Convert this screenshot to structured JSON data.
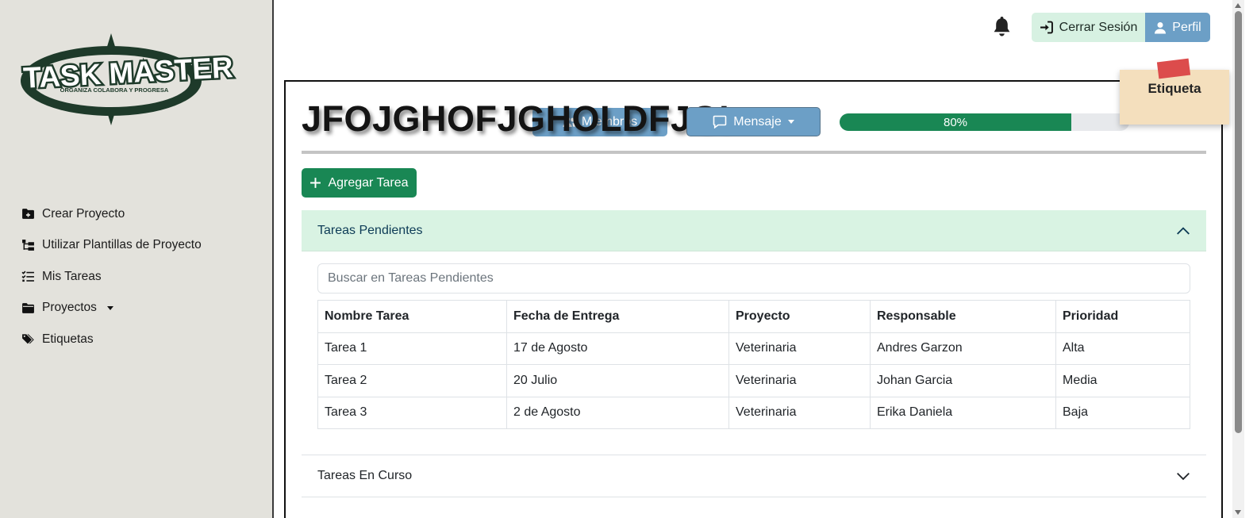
{
  "brand": {
    "name": "TASK MASTER",
    "tagline": "ORGANIZA COLABORA Y PROGRESA"
  },
  "sidebar": {
    "items": [
      {
        "label": "Crear Proyecto",
        "icon": "folder-plus-icon"
      },
      {
        "label": "Utilizar Plantillas de Proyecto",
        "icon": "template-tree-icon"
      },
      {
        "label": "Mis Tareas",
        "icon": "list-check-icon"
      },
      {
        "label": "Proyectos",
        "icon": "folder-icon"
      },
      {
        "label": "Etiquetas",
        "icon": "tags-icon"
      }
    ]
  },
  "header": {
    "logout_label": "Cerrar Sesión",
    "profile_label": "Perfil"
  },
  "project": {
    "title": "JFOJGHOFJGHOLDFJGI",
    "members_label": "Miembros",
    "message_label": "Mensaje",
    "progress": 80,
    "progress_label": "80%",
    "sticky_label": "Etiqueta",
    "add_task_label": "Agregar Tarea"
  },
  "pending": {
    "title": "Tareas Pendientes",
    "search_placeholder": "Buscar en Tareas Pendientes",
    "columns": [
      "Nombre Tarea",
      "Fecha de Entrega",
      "Proyecto",
      "Responsable",
      "Prioridad"
    ],
    "rows": [
      [
        "Tarea 1",
        "17 de Agosto",
        "Veterinaria",
        "Andres Garzon",
        "Alta"
      ],
      [
        "Tarea 2",
        "20 Julio",
        "Veterinaria",
        "Johan Garcia",
        "Media"
      ],
      [
        "Tarea 3",
        "2 de Agosto",
        "Veterinaria",
        "Erika Daniela",
        "Baja"
      ]
    ]
  },
  "in_progress": {
    "title": "Tareas En Curso"
  },
  "colors": {
    "sidebar_bg": "#e3e2dc",
    "brand_green": "#1e3a2a",
    "primary_green": "#198754",
    "accent_blue": "#6c9fc6",
    "light_green": "#d9f3e3",
    "sticky_note": "#f4dfbd",
    "sticky_pin": "#dc4c4c"
  }
}
